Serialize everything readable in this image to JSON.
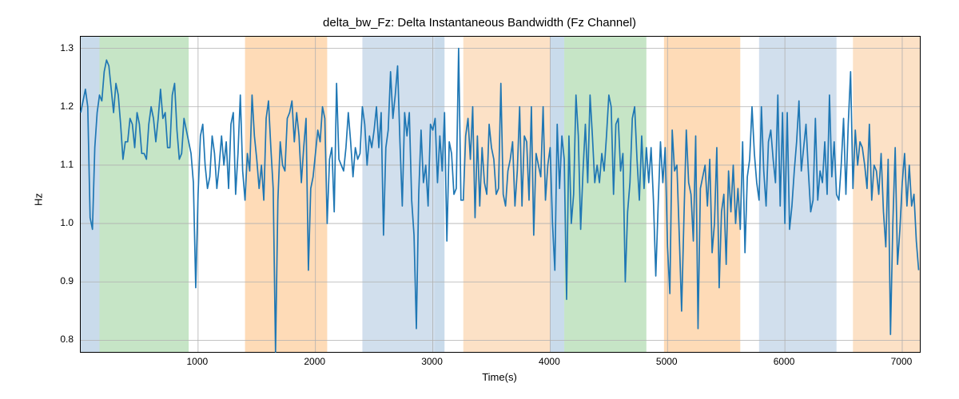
{
  "chart_data": {
    "type": "line",
    "title": "delta_bw_Fz: Delta Instantaneous Bandwidth (Fz Channel)",
    "xlabel": "Time(s)",
    "ylabel": "Hz",
    "xlim": [
      0,
      7150
    ],
    "ylim": [
      0.78,
      1.32
    ],
    "xticks": [
      1000,
      2000,
      3000,
      4000,
      5000,
      6000,
      7000
    ],
    "yticks": [
      0.8,
      0.9,
      1.0,
      1.1,
      1.2,
      1.3
    ],
    "shaded_regions": [
      {
        "x0": 0,
        "x1": 160,
        "color": "blue"
      },
      {
        "x0": 160,
        "x1": 920,
        "color": "green"
      },
      {
        "x0": 1400,
        "x1": 2100,
        "color": "orange"
      },
      {
        "x0": 2400,
        "x1": 3020,
        "color": "ltblue"
      },
      {
        "x0": 3020,
        "x1": 3100,
        "color": "blue"
      },
      {
        "x0": 3260,
        "x1": 4000,
        "color": "ltorange"
      },
      {
        "x0": 4000,
        "x1": 4120,
        "color": "blue"
      },
      {
        "x0": 4120,
        "x1": 4820,
        "color": "green"
      },
      {
        "x0": 4970,
        "x1": 5620,
        "color": "orange"
      },
      {
        "x0": 5780,
        "x1": 6440,
        "color": "ltblue"
      },
      {
        "x0": 6580,
        "x1": 7150,
        "color": "ltorange"
      }
    ],
    "series": [
      {
        "name": "delta_bw_Fz",
        "x_step": 20,
        "values": [
          1.19,
          1.21,
          1.23,
          1.2,
          1.01,
          0.99,
          1.13,
          1.19,
          1.22,
          1.21,
          1.26,
          1.28,
          1.27,
          1.23,
          1.19,
          1.24,
          1.22,
          1.17,
          1.11,
          1.14,
          1.14,
          1.18,
          1.17,
          1.13,
          1.19,
          1.17,
          1.12,
          1.12,
          1.11,
          1.17,
          1.2,
          1.18,
          1.14,
          1.18,
          1.23,
          1.18,
          1.19,
          1.13,
          1.13,
          1.22,
          1.24,
          1.16,
          1.11,
          1.12,
          1.18,
          1.16,
          1.14,
          1.12,
          1.07,
          0.89,
          1.05,
          1.15,
          1.17,
          1.1,
          1.06,
          1.08,
          1.15,
          1.12,
          1.06,
          1.1,
          1.15,
          1.1,
          1.14,
          1.06,
          1.17,
          1.19,
          1.05,
          1.12,
          1.22,
          1.09,
          1.04,
          1.12,
          1.09,
          1.22,
          1.15,
          1.11,
          1.06,
          1.1,
          1.04,
          1.18,
          1.21,
          1.13,
          1.06,
          0.78,
          1.04,
          1.14,
          1.1,
          1.09,
          1.18,
          1.19,
          1.21,
          1.14,
          1.19,
          1.15,
          1.07,
          1.13,
          1.18,
          0.92,
          1.06,
          1.08,
          1.12,
          1.16,
          1.14,
          1.2,
          1.18,
          1.0,
          1.11,
          1.13,
          1.02,
          1.24,
          1.11,
          1.1,
          1.09,
          1.13,
          1.19,
          1.14,
          1.08,
          1.13,
          1.11,
          1.12,
          1.2,
          1.17,
          1.1,
          1.15,
          1.13,
          1.16,
          1.2,
          1.13,
          1.19,
          0.98,
          1.13,
          1.16,
          1.26,
          1.18,
          1.22,
          1.27,
          1.14,
          1.03,
          1.19,
          1.15,
          1.19,
          1.04,
          0.98,
          0.82,
          1.05,
          1.16,
          1.07,
          1.1,
          1.03,
          1.17,
          1.16,
          1.18,
          1.07,
          1.15,
          1.09,
          1.19,
          0.97,
          1.14,
          1.12,
          1.05,
          1.06,
          1.3,
          1.04,
          1.04,
          1.15,
          1.18,
          1.11,
          1.2,
          1.01,
          1.15,
          1.03,
          1.13,
          1.07,
          1.05,
          1.17,
          1.13,
          1.11,
          1.05,
          1.06,
          1.24,
          1.05,
          1.03,
          1.09,
          1.11,
          1.14,
          1.03,
          1.09,
          1.2,
          1.03,
          1.15,
          1.14,
          1.04,
          1.2,
          0.98,
          1.12,
          1.1,
          1.08,
          1.2,
          1.04,
          1.1,
          1.13,
          1.0,
          0.92,
          1.17,
          1.06,
          1.15,
          1.11,
          0.87,
          1.15,
          1.0,
          1.05,
          1.22,
          1.15,
          0.99,
          1.09,
          1.17,
          1.07,
          1.22,
          1.15,
          1.07,
          1.1,
          1.07,
          1.12,
          1.09,
          1.15,
          1.22,
          1.2,
          1.05,
          1.17,
          1.18,
          1.09,
          1.12,
          0.9,
          1.02,
          1.07,
          1.18,
          1.2,
          1.11,
          1.04,
          1.15,
          1.06,
          1.13,
          1.07,
          1.13,
          1.04,
          0.91,
          1.03,
          1.14,
          1.07,
          1.13,
          0.96,
          0.88,
          1.16,
          1.09,
          1.1,
          0.98,
          0.85,
          1.01,
          1.16,
          1.07,
          1.05,
          0.97,
          1.15,
          0.82,
          1.06,
          1.08,
          1.1,
          1.03,
          1.11,
          0.95,
          1.0,
          1.13,
          0.89,
          1.02,
          1.05,
          0.93,
          1.09,
          1.02,
          1.1,
          1.0,
          1.06,
          0.99,
          1.14,
          0.95,
          1.08,
          1.11,
          1.2,
          1.12,
          1.07,
          1.04,
          1.2,
          1.09,
          1.03,
          1.14,
          1.16,
          1.11,
          1.07,
          1.22,
          1.03,
          1.19,
          1.0,
          1.19,
          0.99,
          1.03,
          1.09,
          1.14,
          1.21,
          1.09,
          1.13,
          1.17,
          1.09,
          1.02,
          1.04,
          1.18,
          1.04,
          1.09,
          1.07,
          1.14,
          1.05,
          1.22,
          1.08,
          1.14,
          1.05,
          1.04,
          1.1,
          1.18,
          1.05,
          1.17,
          1.26,
          1.06,
          1.16,
          1.1,
          1.14,
          1.13,
          1.1,
          1.06,
          1.17,
          1.04,
          1.1,
          1.09,
          1.05,
          1.12,
          1.02,
          0.96,
          1.11,
          0.81,
          1.0,
          1.13,
          0.93,
          0.99,
          1.07,
          1.12,
          1.03,
          1.1,
          1.03,
          1.05,
          0.97,
          0.92
        ]
      }
    ]
  }
}
